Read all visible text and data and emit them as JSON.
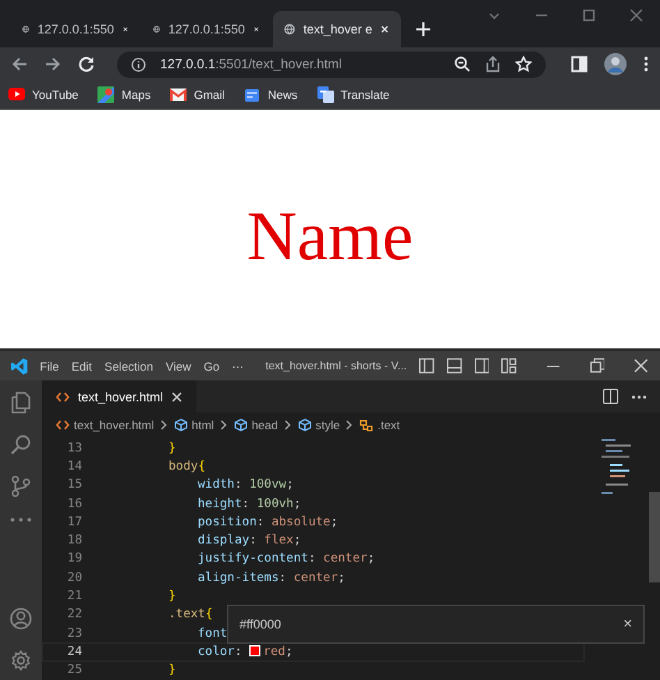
{
  "browser": {
    "tabs": [
      {
        "title": "127.0.0.1:550",
        "selected": false
      },
      {
        "title": "127.0.0.1:550",
        "selected": false
      },
      {
        "title": "text_hover e",
        "selected": true
      }
    ],
    "address": {
      "host": "127.0.0.1",
      "path": ":5501/text_hover.html"
    },
    "bookmarks": [
      {
        "label": "YouTube",
        "kind": "youtube"
      },
      {
        "label": "Maps",
        "kind": "maps"
      },
      {
        "label": "Gmail",
        "kind": "gmail"
      },
      {
        "label": "News",
        "kind": "news"
      },
      {
        "label": "Translate",
        "kind": "translate"
      }
    ]
  },
  "page": {
    "heading": "Name"
  },
  "editor": {
    "menu": [
      "File",
      "Edit",
      "Selection",
      "View",
      "Go",
      "⋯"
    ],
    "title": "text_hover.html - shorts - V...",
    "tabs": [
      {
        "label": "text_hover.html",
        "selected": true
      }
    ],
    "breadcrumb": [
      {
        "label": "text_hover.html",
        "kind": "file"
      },
      {
        "label": "html",
        "kind": "element"
      },
      {
        "label": "head",
        "kind": "element"
      },
      {
        "label": "style",
        "kind": "element"
      },
      {
        "label": ".text",
        "kind": "selector"
      }
    ],
    "lines": [
      {
        "number": "13",
        "current": false,
        "kind": "rule",
        "tokens": [
          {
            "kind": "brace",
            "text": "}"
          }
        ]
      },
      {
        "number": "14",
        "current": false,
        "kind": "rule",
        "tokens": [
          {
            "kind": "selector",
            "text": "body"
          },
          {
            "kind": "brace",
            "text": "{"
          }
        ]
      },
      {
        "number": "15",
        "current": false,
        "kind": "declaration",
        "tokens": [
          {
            "kind": "property",
            "text": "width"
          },
          {
            "kind": "plain",
            "text": ": "
          },
          {
            "kind": "number",
            "text": "100vw"
          },
          {
            "kind": "plain",
            "text": ";"
          }
        ]
      },
      {
        "number": "16",
        "current": false,
        "kind": "declaration",
        "tokens": [
          {
            "kind": "property",
            "text": "height"
          },
          {
            "kind": "plain",
            "text": ": "
          },
          {
            "kind": "number",
            "text": "100vh"
          },
          {
            "kind": "plain",
            "text": ";"
          }
        ]
      },
      {
        "number": "17",
        "current": false,
        "kind": "declaration",
        "tokens": [
          {
            "kind": "property",
            "text": "position"
          },
          {
            "kind": "plain",
            "text": ": "
          },
          {
            "kind": "value",
            "text": "absolute"
          },
          {
            "kind": "plain",
            "text": ";"
          }
        ]
      },
      {
        "number": "18",
        "current": false,
        "kind": "declaration",
        "tokens": [
          {
            "kind": "property",
            "text": "display"
          },
          {
            "kind": "plain",
            "text": ": "
          },
          {
            "kind": "value",
            "text": "flex"
          },
          {
            "kind": "plain",
            "text": ";"
          }
        ]
      },
      {
        "number": "19",
        "current": false,
        "kind": "declaration",
        "tokens": [
          {
            "kind": "property",
            "text": "justify-content"
          },
          {
            "kind": "plain",
            "text": ": "
          },
          {
            "kind": "value",
            "text": "center"
          },
          {
            "kind": "plain",
            "text": ";"
          }
        ]
      },
      {
        "number": "20",
        "current": false,
        "kind": "declaration",
        "tokens": [
          {
            "kind": "property",
            "text": "align-items"
          },
          {
            "kind": "plain",
            "text": ": "
          },
          {
            "kind": "value",
            "text": "center"
          },
          {
            "kind": "plain",
            "text": ";"
          }
        ]
      },
      {
        "number": "21",
        "current": false,
        "kind": "rule",
        "tokens": [
          {
            "kind": "brace",
            "text": "}"
          }
        ]
      },
      {
        "number": "22",
        "current": false,
        "kind": "rule",
        "tokens": [
          {
            "kind": "selector",
            "text": ".text"
          },
          {
            "kind": "brace",
            "text": "{"
          }
        ]
      },
      {
        "number": "23",
        "current": false,
        "kind": "declaration",
        "tokens": [
          {
            "kind": "property",
            "text": "font"
          }
        ]
      },
      {
        "number": "24",
        "current": true,
        "kind": "declaration",
        "tokens": [
          {
            "kind": "property",
            "text": "color"
          },
          {
            "kind": "plain",
            "text": ": "
          },
          {
            "kind": "swatch",
            "color": "#ff0000"
          },
          {
            "kind": "value",
            "text": "red"
          },
          {
            "kind": "plain",
            "text": ";"
          }
        ]
      },
      {
        "number": "25",
        "current": false,
        "kind": "rule",
        "tokens": [
          {
            "kind": "brace",
            "text": "}"
          }
        ]
      }
    ],
    "hover": {
      "text": "#ff0000",
      "close": "×"
    }
  }
}
